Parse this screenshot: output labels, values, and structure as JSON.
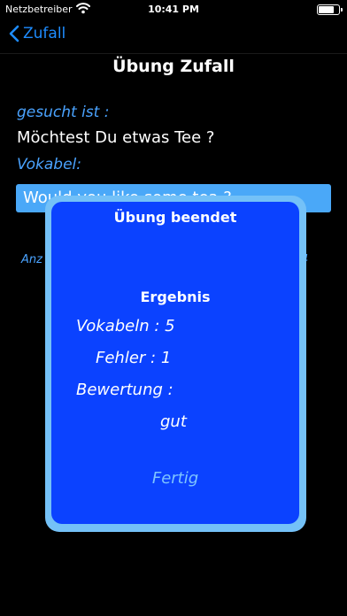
{
  "status_bar": {
    "carrier": "Netzbetreiber",
    "time": "10:41 PM",
    "battery_percent": 85
  },
  "nav": {
    "back_label": "Zufall"
  },
  "main": {
    "title": "Übung Zufall",
    "label_searched": "gesucht ist :",
    "question": "Möchtest Du etwas Tee ?",
    "label_vocab": "Vokabel:",
    "answer": "Would you like some tea ?",
    "count_label_partial": "Anz",
    "count_value_partial": "4"
  },
  "dialog": {
    "title": "Übung beendet",
    "result_heading": "Ergebnis",
    "vocab_line": "Vokabeln : 5",
    "errors_line": "Fehler : 1",
    "rating_label": "Bewertung :",
    "rating_value": "gut",
    "done_button": "Fertig"
  },
  "colors": {
    "accent": "#1e8cff",
    "label": "#4aa3ff",
    "field": "#4aa8f8",
    "dialog": "#0b42ff",
    "dialog_border": "#74c1f7"
  }
}
